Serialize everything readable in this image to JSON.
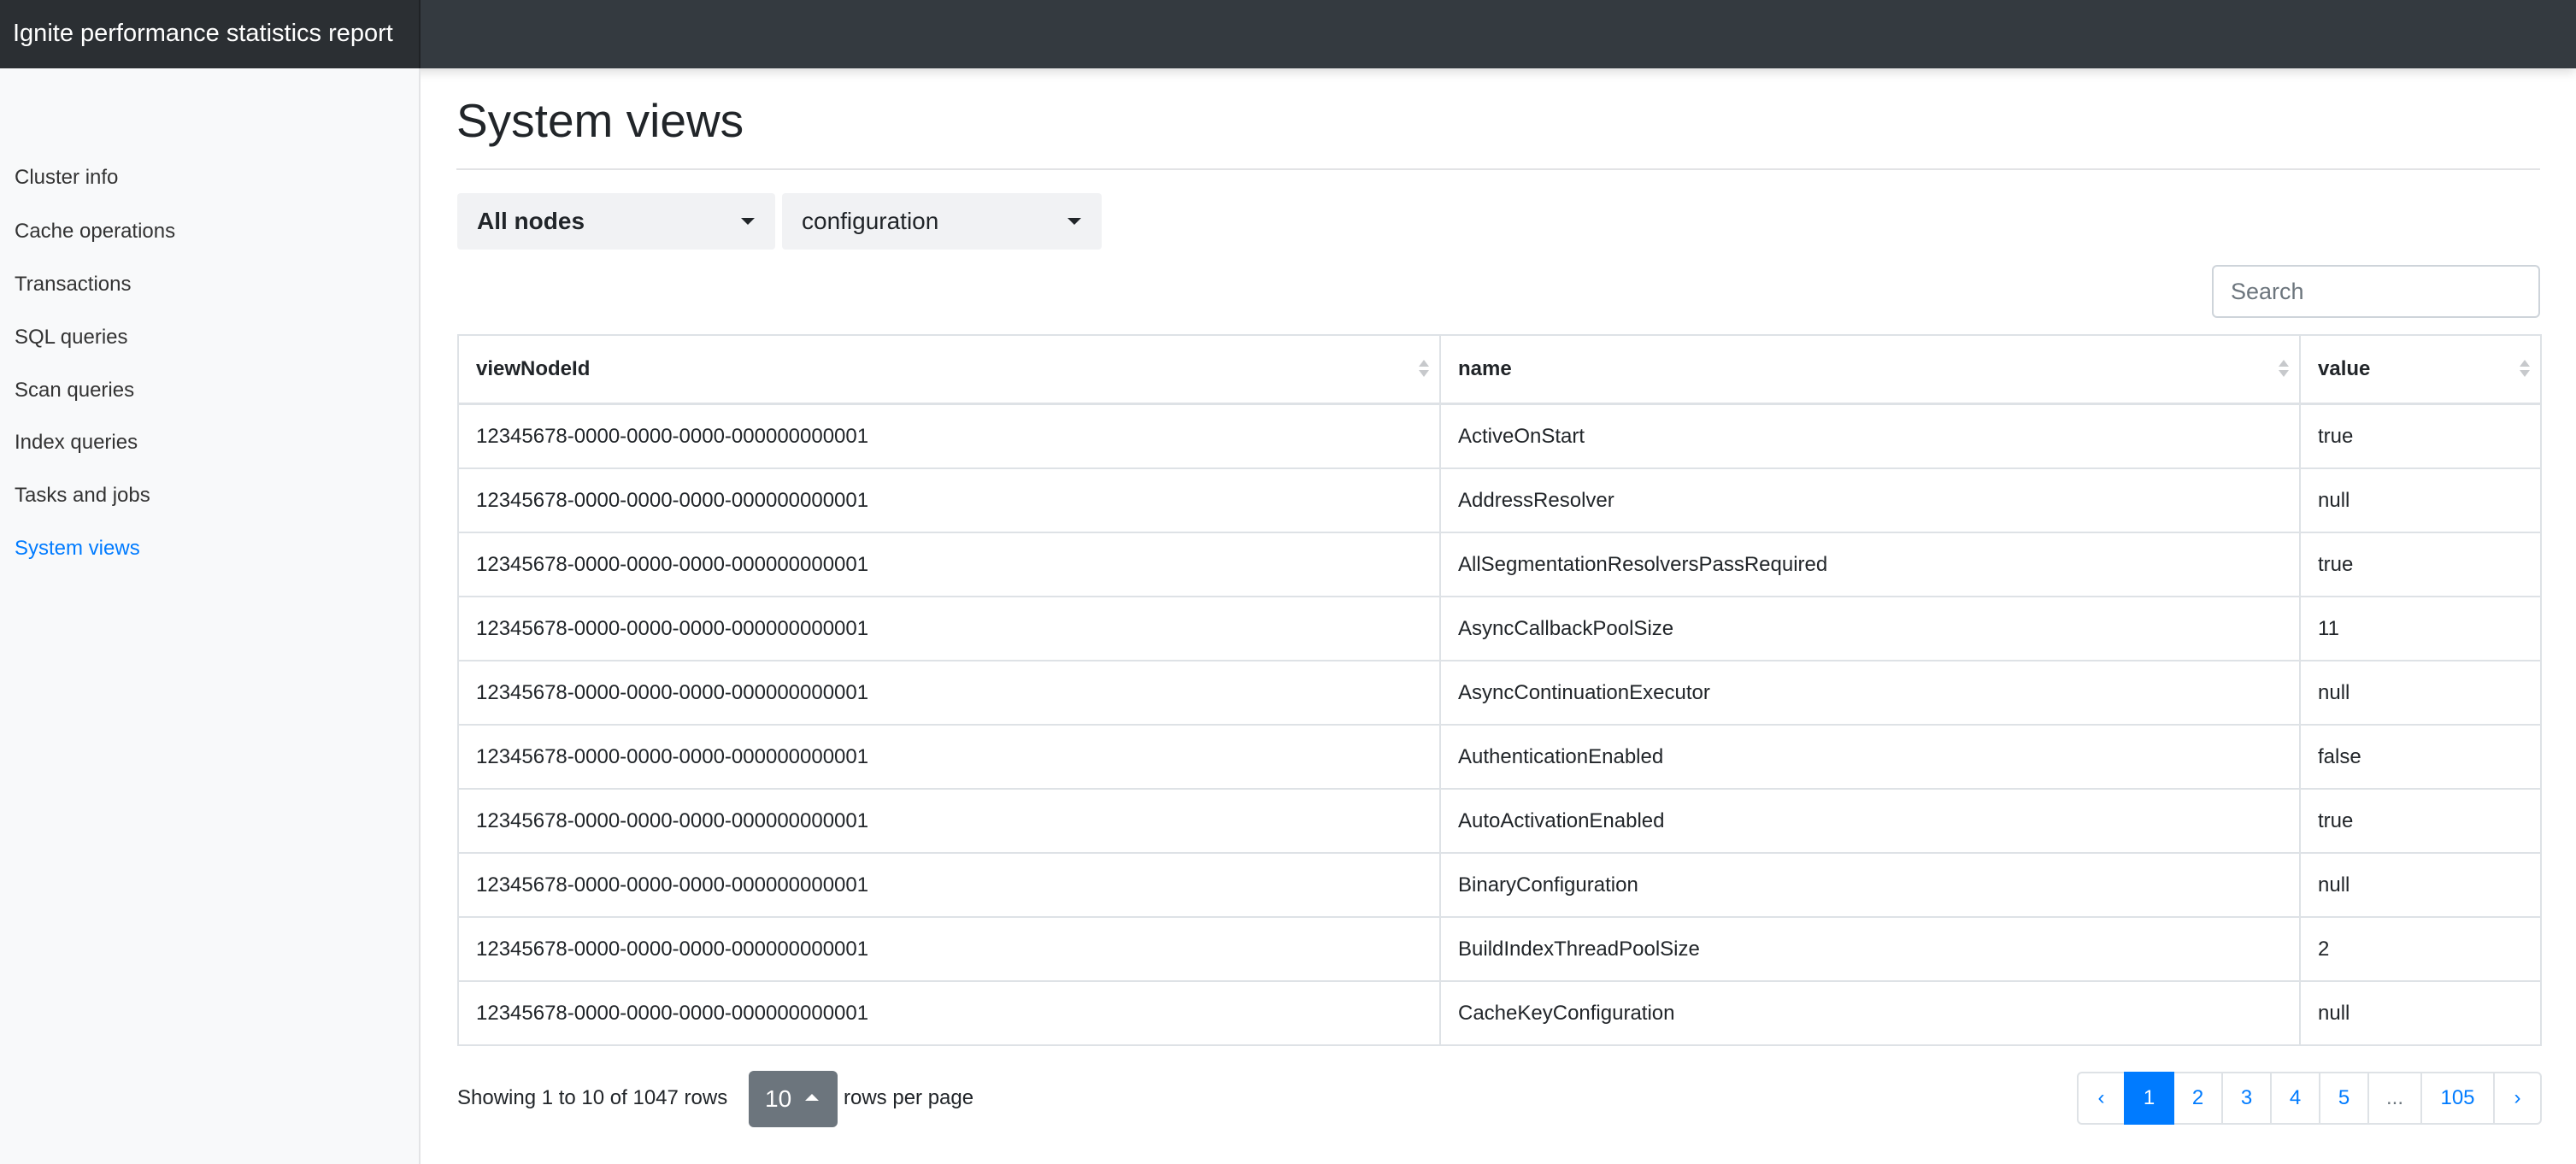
{
  "app": {
    "title": "Ignite performance statistics report"
  },
  "sidebar": {
    "items": [
      {
        "label": "Cluster info",
        "active": false
      },
      {
        "label": "Cache operations",
        "active": false
      },
      {
        "label": "Transactions",
        "active": false
      },
      {
        "label": "SQL queries",
        "active": false
      },
      {
        "label": "Scan queries",
        "active": false
      },
      {
        "label": "Index queries",
        "active": false
      },
      {
        "label": "Tasks and jobs",
        "active": false
      },
      {
        "label": "System views",
        "active": true
      }
    ]
  },
  "main": {
    "title": "System views",
    "filters": {
      "node_select": "All nodes",
      "view_select": "configuration"
    },
    "search": {
      "placeholder": "Search",
      "value": ""
    },
    "table": {
      "columns": [
        "viewNodeId",
        "name",
        "value"
      ],
      "rows": [
        [
          "12345678-0000-0000-0000-000000000001",
          "ActiveOnStart",
          "true"
        ],
        [
          "12345678-0000-0000-0000-000000000001",
          "AddressResolver",
          "null"
        ],
        [
          "12345678-0000-0000-0000-000000000001",
          "AllSegmentationResolversPassRequired",
          "true"
        ],
        [
          "12345678-0000-0000-0000-000000000001",
          "AsyncCallbackPoolSize",
          "11"
        ],
        [
          "12345678-0000-0000-0000-000000000001",
          "AsyncContinuationExecutor",
          "null"
        ],
        [
          "12345678-0000-0000-0000-000000000001",
          "AuthenticationEnabled",
          "false"
        ],
        [
          "12345678-0000-0000-0000-000000000001",
          "AutoActivationEnabled",
          "true"
        ],
        [
          "12345678-0000-0000-0000-000000000001",
          "BinaryConfiguration",
          "null"
        ],
        [
          "12345678-0000-0000-0000-000000000001",
          "BuildIndexThreadPoolSize",
          "2"
        ],
        [
          "12345678-0000-0000-0000-000000000001",
          "CacheKeyConfiguration",
          "null"
        ]
      ]
    },
    "footer": {
      "showing_text": "Showing 1 to 10 of 1047 rows",
      "page_size": "10",
      "rows_per_page_label": "rows per page"
    },
    "pagination": {
      "prev": "‹",
      "next": "›",
      "pages": [
        "1",
        "2",
        "3",
        "4",
        "5",
        "...",
        "105"
      ],
      "current": "1"
    }
  },
  "colors": {
    "topbar": "#343a40",
    "accent": "#007bff",
    "sidebar_bg": "#f8f9fa",
    "page_size_button": "#6c757d"
  }
}
